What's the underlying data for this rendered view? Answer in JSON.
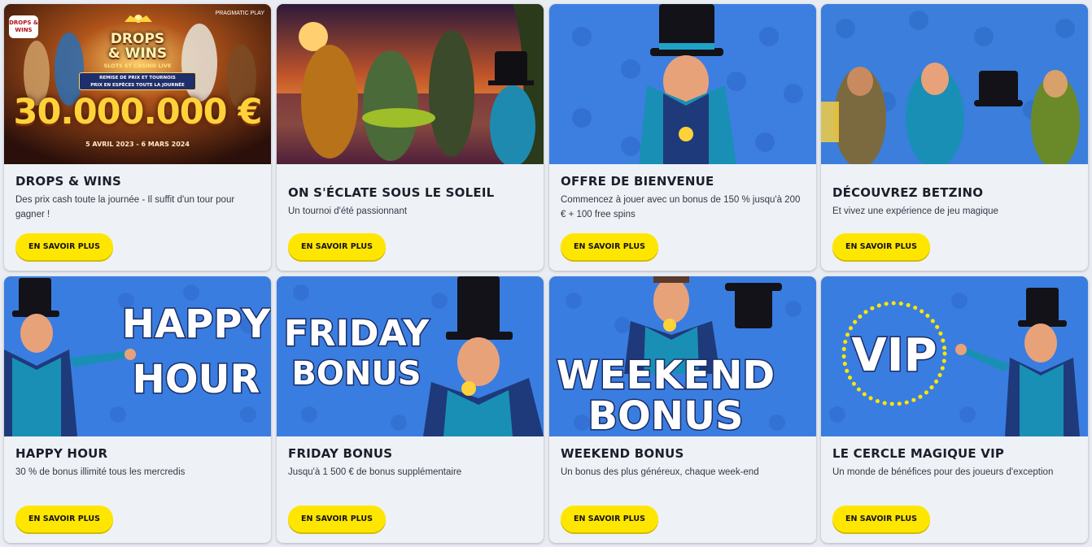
{
  "cards": [
    {
      "title": "DROPS & WINS",
      "description": "Des prix cash toute la journée - Il suffit d'un tour pour gagner !",
      "cta": "EN SAVOIR PLUS",
      "banner": {
        "logo_small": "DROPS & WINS",
        "provider": "PRAGMATIC PLAY",
        "heading_1": "DROPS",
        "heading_2": "& WINS",
        "subheading": "SLOTS ET CASINO LIVE",
        "ribbon_1": "REMISE DE PRIX ET TOURNOIS",
        "ribbon_2": "PRIX EN ESPÈCES TOUTE LA JOURNÉE",
        "amount": "30.000.000 €",
        "dates": "5 AVRIL 2023 - 6 MARS 2024"
      }
    },
    {
      "title": "ON S'ÉCLATE SOUS LE SOLEIL",
      "description": "Un tournoi d'été passionnant",
      "cta": "EN SAVOIR PLUS"
    },
    {
      "title": "OFFRE DE BIENVENUE",
      "description": "Commencez à jouer avec un bonus de 150 % jusqu'à 200 € + 100 free spins",
      "cta": "EN SAVOIR PLUS"
    },
    {
      "title": "DÉCOUVREZ BETZINO",
      "description": "Et vivez une expérience de jeu magique",
      "cta": "EN SAVOIR PLUS"
    },
    {
      "title": "HAPPY HOUR",
      "description": "30 % de bonus illimité tous les mercredis",
      "cta": "EN SAVOIR PLUS",
      "banner": {
        "line_1": "HAPPY",
        "line_2": "HOUR"
      }
    },
    {
      "title": "FRIDAY BONUS",
      "description": "Jusqu'à 1 500 € de bonus supplémentaire",
      "cta": "EN SAVOIR PLUS",
      "banner": {
        "line_1": "FRIDAY",
        "line_2": "BONUS"
      }
    },
    {
      "title": "WEEKEND BONUS",
      "description": "Un bonus des plus généreux, chaque week-end",
      "cta": "EN SAVOIR PLUS",
      "banner": {
        "line_1": "WEEKEND",
        "line_2": "BONUS"
      }
    },
    {
      "title": "LE CERCLE MAGIQUE VIP",
      "description": "Un monde de bénéfices pour des joueurs d'exception",
      "cta": "EN SAVOIR PLUS",
      "banner": {
        "line_1": "VIP"
      }
    }
  ],
  "colors": {
    "accent_yellow": "#ffe600",
    "banner_blue": "#3d7fe0",
    "card_bg": "#eef2f7",
    "title_text": "#1c1f2a"
  }
}
